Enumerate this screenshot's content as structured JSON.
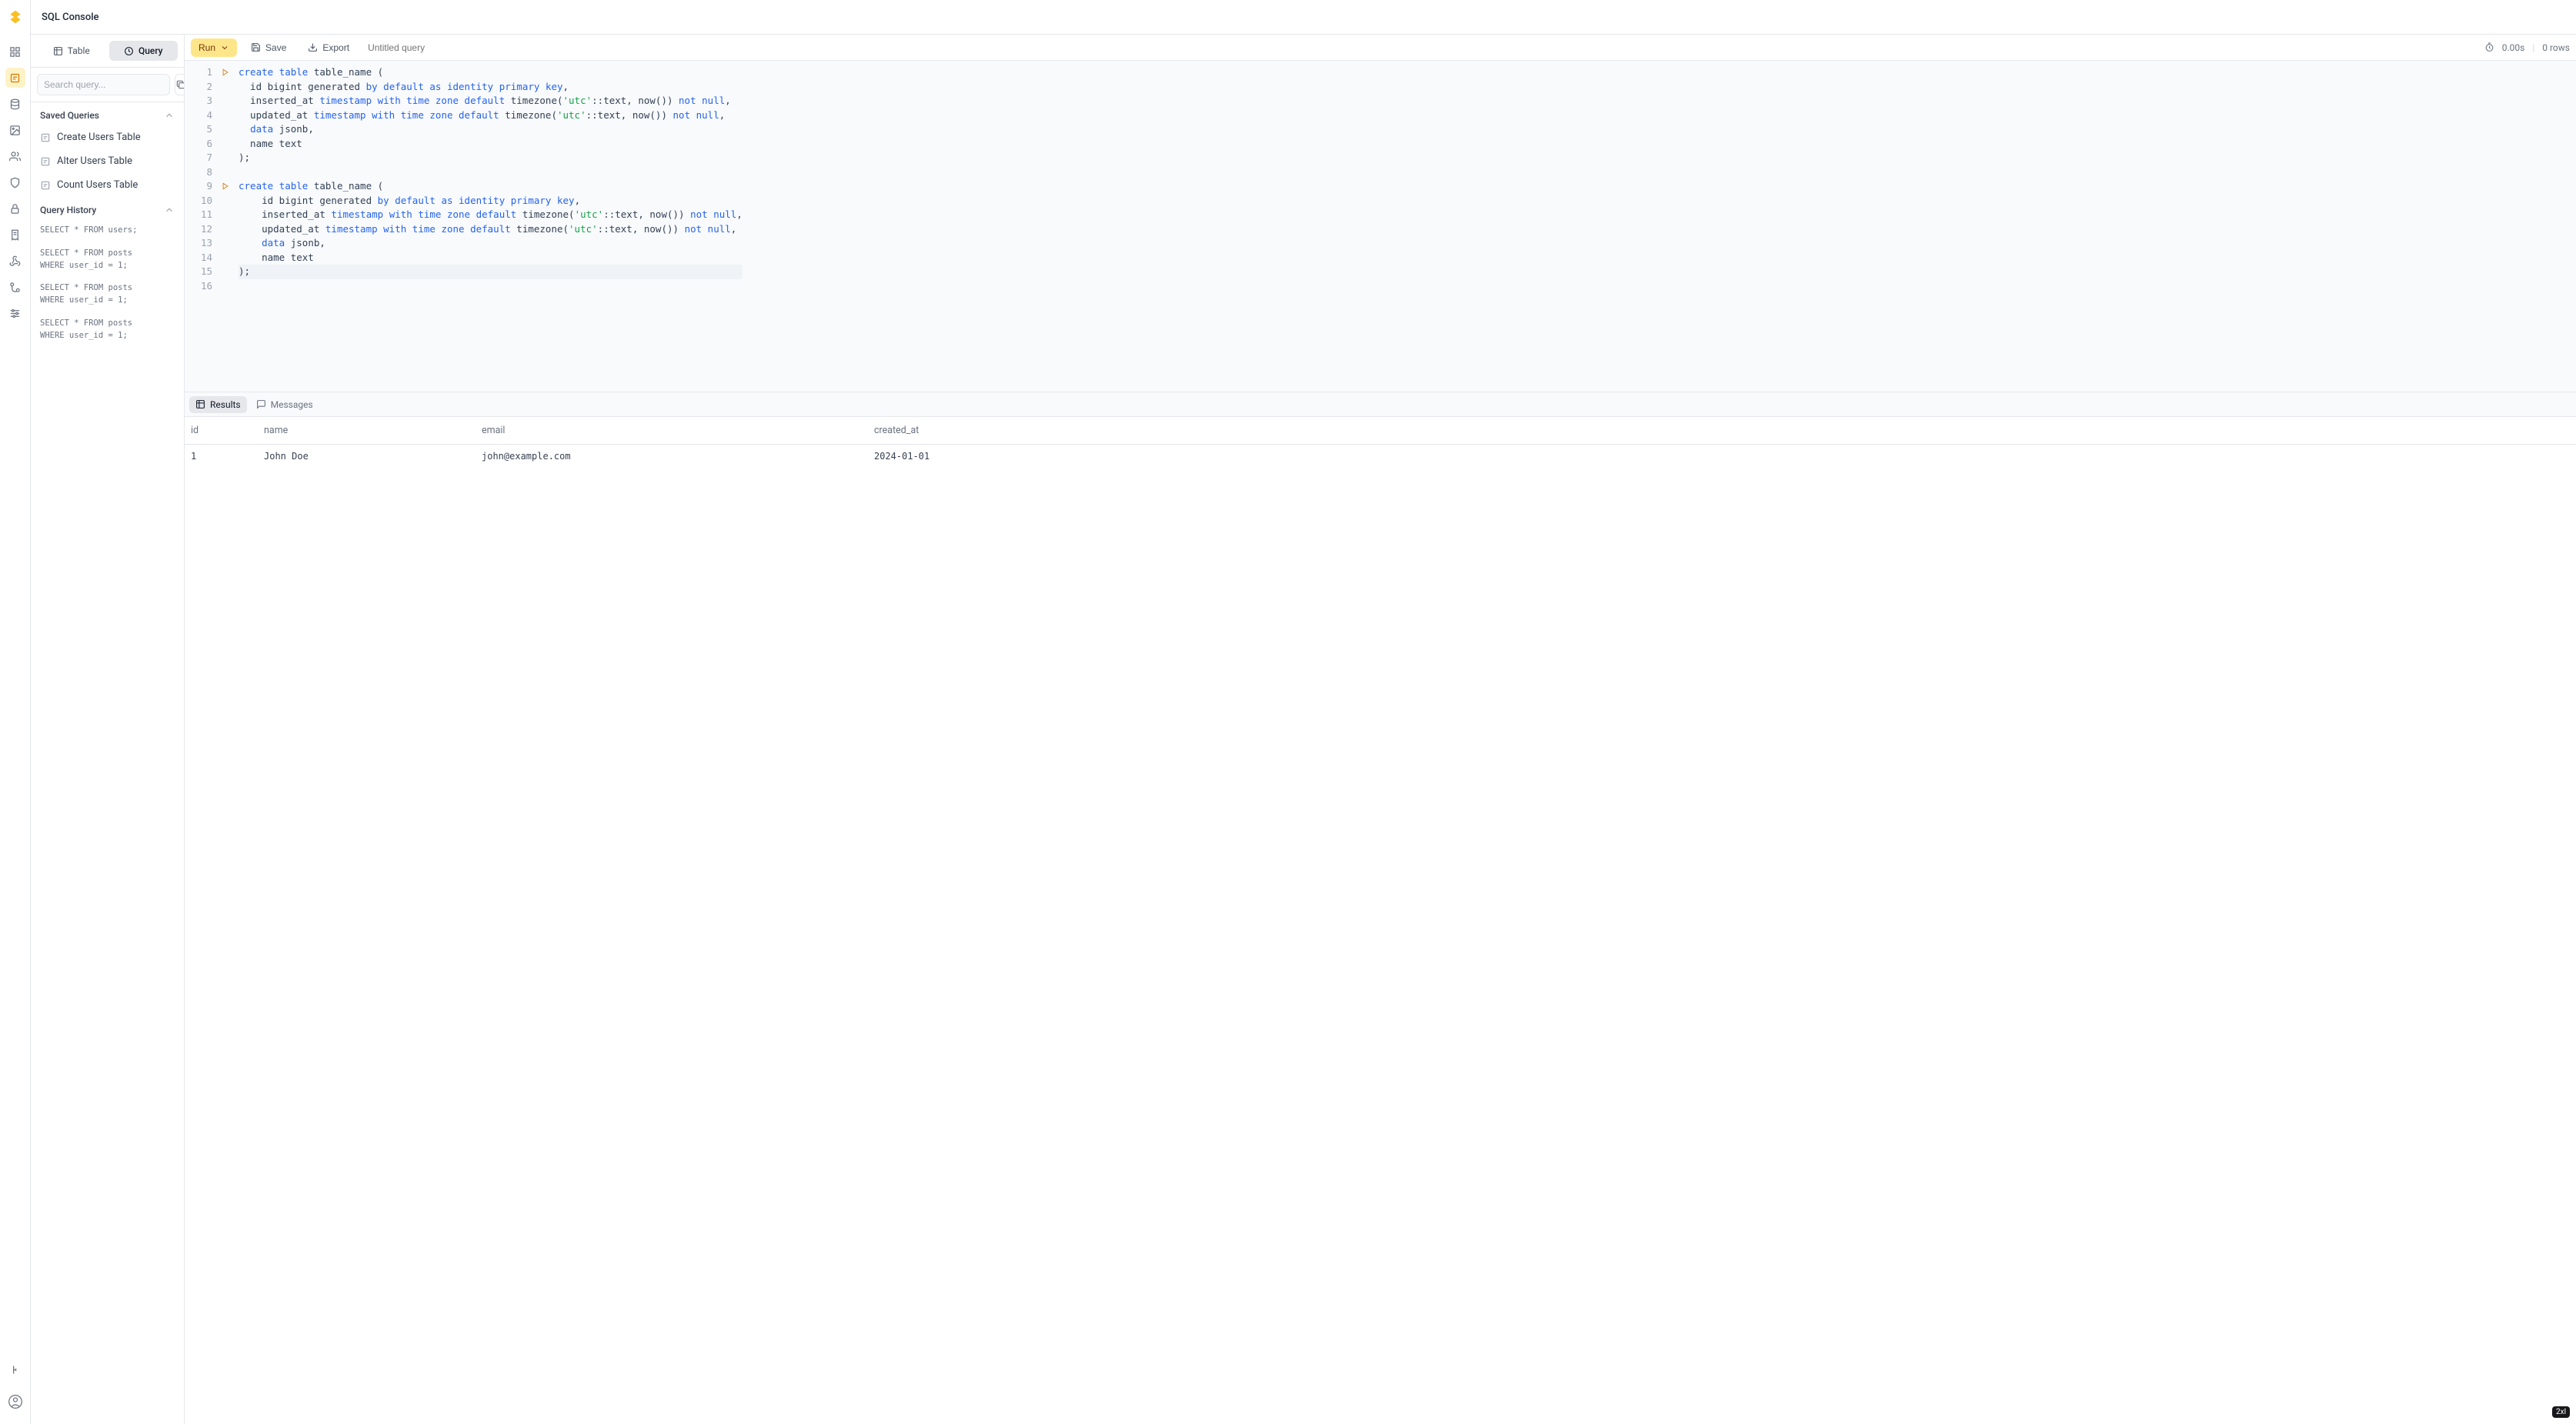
{
  "header": {
    "title": "SQL Console"
  },
  "sidebar": {
    "tabs": {
      "table": "Table",
      "query": "Query"
    },
    "search_placeholder": "Search query...",
    "sections": {
      "saved": {
        "title": "Saved Queries",
        "items": [
          {
            "label": "Create Users Table"
          },
          {
            "label": "Alter Users Table"
          },
          {
            "label": "Count Users Table"
          }
        ]
      },
      "history": {
        "title": "Query History",
        "items": [
          "SELECT * FROM users;",
          "SELECT * FROM posts\nWHERE user_id = 1;",
          "SELECT * FROM posts\nWHERE user_id = 1;",
          "SELECT * FROM posts\nWHERE user_id = 1;"
        ]
      }
    }
  },
  "toolbar": {
    "run": "Run",
    "save": "Save",
    "export": "Export",
    "query_name_placeholder": "Untitled query",
    "time": "0.00s",
    "rows": "0 rows"
  },
  "editor": {
    "line_count": 16,
    "run_markers": [
      1,
      9
    ],
    "lines_html": [
      "<span class='kw'>create</span> <span class='kw'>table</span> table_name (",
      "  id bigint generated <span class='kw'>by</span> <span class='kw'>default</span> <span class='kw'>as</span> <span class='kw'>identity</span> <span class='kw'>primary</span> <span class='kw'>key</span>,",
      "  inserted_at <span class='kw2'>timestamp</span> <span class='kw'>with</span> <span class='kw2'>time</span> <span class='kw'>zone</span> <span class='kw'>default</span> timezone(<span class='str'>'utc'</span>::text, now()) <span class='kw'>not</span> <span class='kw'>null</span>,",
      "  updated_at <span class='kw2'>timestamp</span> <span class='kw'>with</span> <span class='kw2'>time</span> <span class='kw'>zone</span> <span class='kw'>default</span> timezone(<span class='str'>'utc'</span>::text, now()) <span class='kw'>not</span> <span class='kw'>null</span>,",
      "  <span class='kw'>data</span> jsonb,",
      "  name text",
      ");",
      "",
      "<span class='kw'>create</span> <span class='kw'>table</span> table_name (",
      "    id bigint generated <span class='kw'>by</span> <span class='kw'>default</span> <span class='kw'>as</span> <span class='kw'>identity</span> <span class='kw'>primary</span> <span class='kw'>key</span>,",
      "    inserted_at <span class='kw2'>timestamp</span> <span class='kw'>with</span> <span class='kw2'>time</span> <span class='kw'>zone</span> <span class='kw'>default</span> timezone(<span class='str'>'utc'</span>::text, now()) <span class='kw'>not</span> <span class='kw'>null</span>,",
      "    updated_at <span class='kw2'>timestamp</span> <span class='kw'>with</span> <span class='kw2'>time</span> <span class='kw'>zone</span> <span class='kw'>default</span> timezone(<span class='str'>'utc'</span>::text, now()) <span class='kw'>not</span> <span class='kw'>null</span>,",
      "    <span class='kw'>data</span> jsonb,",
      "    name text",
      ");",
      ""
    ],
    "current_line": 15
  },
  "results": {
    "tabs": {
      "results": "Results",
      "messages": "Messages"
    },
    "columns": [
      "id",
      "name",
      "email",
      "created_at"
    ],
    "rows": [
      [
        "1",
        "John Doe",
        "john@example.com",
        "2024-01-01"
      ]
    ]
  },
  "breakpoint_badge": "2xl"
}
